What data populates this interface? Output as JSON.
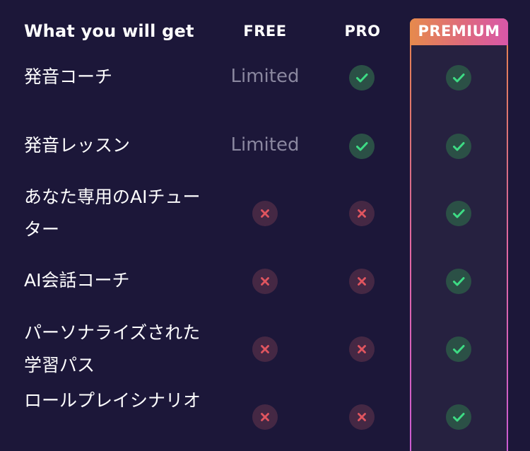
{
  "header": {
    "title": "What you will get",
    "plans": [
      "FREE",
      "PRO",
      "PREMIUM"
    ]
  },
  "colors": {
    "background": "#1c1739",
    "premium_column": "#262140",
    "check_green": "#3ddc84",
    "cross_red": "#e0555f",
    "limited_text": "#8a879f"
  },
  "features": [
    {
      "name": "発音コーチ",
      "free": "Limited",
      "pro": "check",
      "premium": "check"
    },
    {
      "name": "発音レッスン",
      "free": "Limited",
      "pro": "check",
      "premium": "check"
    },
    {
      "name": "あなた専用のAIチューター",
      "free": "cross",
      "pro": "cross",
      "premium": "check"
    },
    {
      "name": "AI会話コーチ",
      "free": "cross",
      "pro": "cross",
      "premium": "check"
    },
    {
      "name": "パーソナライズされた学習パス",
      "free": "cross",
      "pro": "cross",
      "premium": "check"
    },
    {
      "name": "ロールプレイシナリオ",
      "free": "cross",
      "pro": "cross",
      "premium": "check"
    }
  ]
}
